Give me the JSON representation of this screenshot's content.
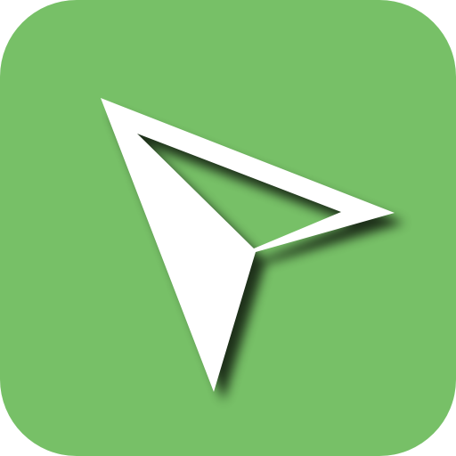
{
  "app_icon": {
    "icon_name": "navigation-arrow-icon",
    "background_color": "#77c067",
    "glyph_color": "#ffffff",
    "shadow_color": "#000000"
  }
}
